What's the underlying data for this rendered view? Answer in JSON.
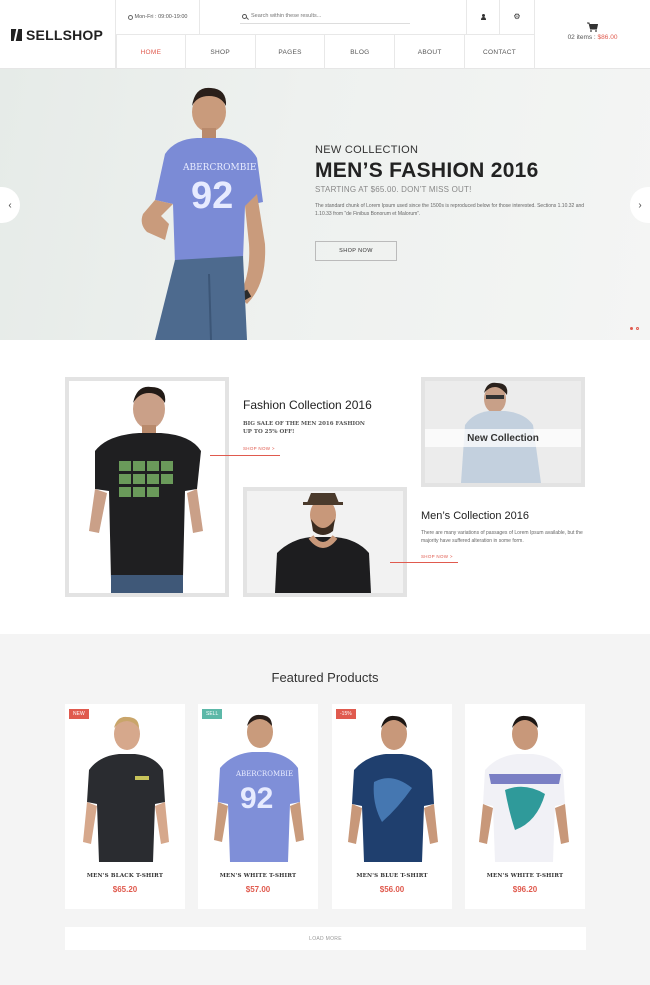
{
  "header": {
    "logo": "SELLSHOP",
    "hours": "Mon-Fri : 09:00-19:00",
    "search_placeholder": "Search within these results...",
    "nav": [
      "HOME",
      "SHOP",
      "PAGES",
      "BLOG",
      "ABOUT",
      "CONTACT"
    ],
    "active_nav": "HOME",
    "cart_items": "02 items : ",
    "cart_total": "$86.00"
  },
  "hero": {
    "kicker": "NEW COLLECTION",
    "title": "MEN’S FASHION 2016",
    "subtitle": "STARTING AT $65.00. DON’T MISS OUT!",
    "description": "The standard chunk of Lorem Ipsum used since the 1500s is reproduced below for those interested. Sections 1.10.32 and 1.10.33 from “de Finibus Bonorum et Malorum”.",
    "button": "SHOP NOW",
    "shirt_print": "ABERCROMBIE 92",
    "slides": 2,
    "active_slide": 1
  },
  "collections": {
    "fashion": {
      "title": "Fashion Collection 2016",
      "desc_line1": "BIG SALE OF THE MEN 2016 FASHION",
      "desc_line2": "UP TO 25% OFF!",
      "link": "SHOP NOW >"
    },
    "new_label": "New Collection",
    "mens": {
      "title": "Men’s Collection 2016",
      "description": "There are many variations of passages of Lorem Ipsum available, but the majority have suffered alteration in some form.",
      "link": "SHOP NOW >"
    }
  },
  "featured": {
    "title": "Featured Products",
    "products": [
      {
        "name": "MEN'S BLACK T-SHIRT",
        "price": "$65.20",
        "badge": "NEW",
        "shirt_color": "#2a2c30"
      },
      {
        "name": "MEN'S WHITE T-SHIRT",
        "price": "$57.00",
        "badge": "SELL",
        "shirt_color": "#7f8fd8"
      },
      {
        "name": "MEN'S BLUE T-SHIRT",
        "price": "$56.00",
        "badge": "-15%",
        "shirt_color": "#1f3f6e"
      },
      {
        "name": "MEN'S WHITE T-SHIRT",
        "price": "$96.20",
        "badge": "",
        "shirt_color": "#f1f1f6"
      }
    ],
    "load_more": "LOAD MORE"
  },
  "colors": {
    "accent": "#e05a4e",
    "sell_badge": "#5cb8a8"
  }
}
